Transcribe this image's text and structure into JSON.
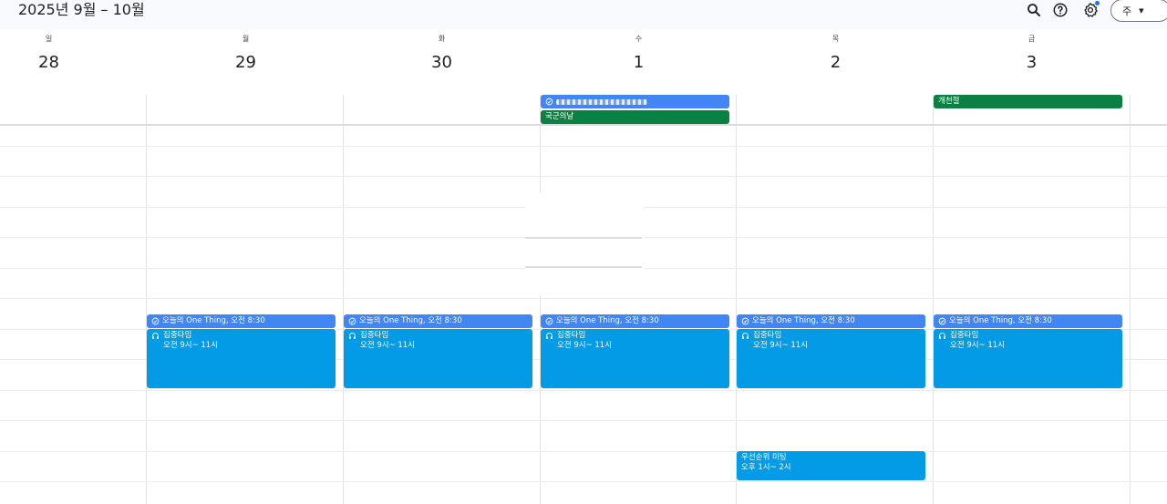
{
  "header": {
    "title": "2025년 9월 – 10월",
    "view_label": "주",
    "icons": [
      "search-icon",
      "help-icon",
      "settings-icon"
    ]
  },
  "days": [
    {
      "name": "일",
      "num": "28"
    },
    {
      "name": "월",
      "num": "29"
    },
    {
      "name": "화",
      "num": "30"
    },
    {
      "name": "수",
      "num": "1"
    },
    {
      "name": "목",
      "num": "2"
    },
    {
      "name": "금",
      "num": "3"
    }
  ],
  "all_day": {
    "holiday_wed": "국군의날",
    "holiday_fri": "개천절"
  },
  "events": {
    "task_label": "오늘의 One Thing, 오전 8:30",
    "focus_title": "집중타임",
    "focus_time": "오전 9시~ 11시",
    "meeting_title": "우선순위 미팅",
    "meeting_time": "오후 1시~ 2시"
  },
  "colors": {
    "task": "#4285f4",
    "holiday": "#0b8043",
    "event": "#039be5"
  }
}
